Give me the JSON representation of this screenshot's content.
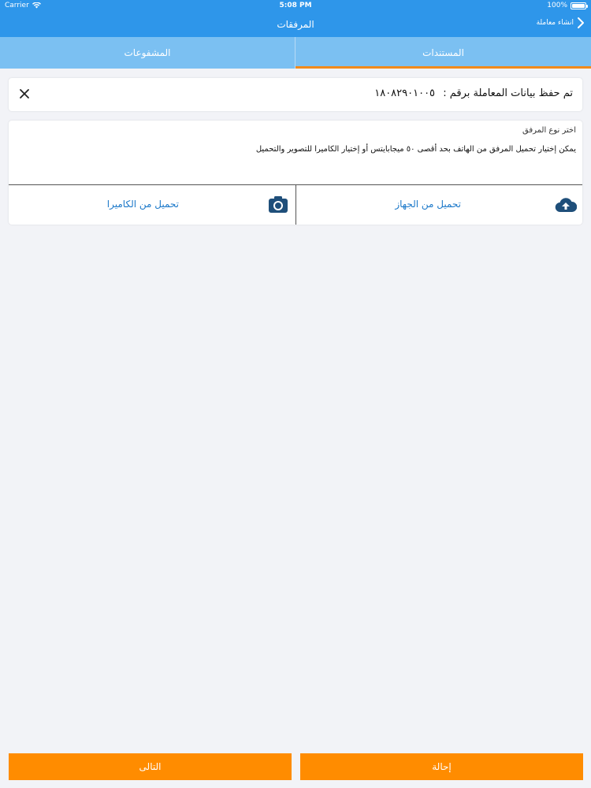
{
  "status_bar": {
    "carrier": "Carrier",
    "time": "5:08 PM",
    "battery": "100%"
  },
  "nav": {
    "title": "المرفقات",
    "back_label": "انشاء معاملة"
  },
  "tabs": [
    {
      "label": "المشفوعات",
      "active": false
    },
    {
      "label": "المستندات",
      "active": true
    }
  ],
  "alert": {
    "message": "تم حفظ بيانات المعاملة برقم :",
    "number": "١٨٠٨٢٩٠١٠٠٥"
  },
  "attachment": {
    "type_label": "اختر نوع المرفق",
    "description": "يمكن إختيار تحميل المرفق من الهاتف بحد أقصى ٥٠ ميجابايتس أو إختيار الكاميرا للتصوير والتحميل",
    "device_button": "تحميل من الجهاز",
    "camera_button": "تحميل من الكاميرا"
  },
  "buttons": {
    "next": "التالى",
    "refer": "إحالة"
  },
  "colors": {
    "header": "#2e96ea",
    "tabs": "#7bc0f2",
    "accent": "#ff8c00",
    "link": "#1b78c9"
  }
}
